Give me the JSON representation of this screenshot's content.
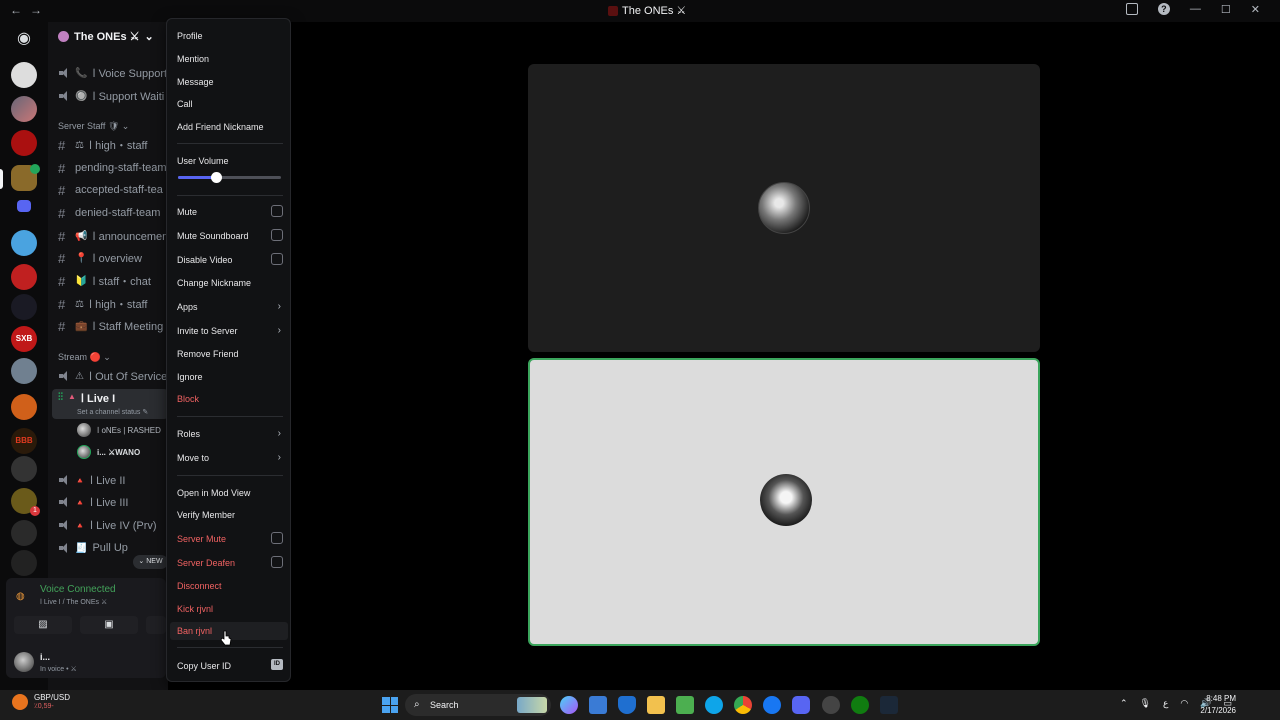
{
  "window": {
    "title": "The ONEs ⚔"
  },
  "sidebar": {
    "server_name": "The ONEs ⚔",
    "channels_top": [
      {
        "label": "ا Voice Support",
        "emoji": "📞"
      },
      {
        "label": "ا Support Waiti",
        "emoji": "🔘"
      }
    ],
    "category_staff": "Server Staff 🛡 ⌄",
    "staff_channels": [
      {
        "label": "ا high・staff",
        "emoji": "⚖"
      },
      {
        "label": "pending-staff-team",
        "emoji": ""
      },
      {
        "label": "accepted-staff-tea",
        "emoji": ""
      },
      {
        "label": "denied-staff-team",
        "emoji": ""
      },
      {
        "label": "ا announcemen",
        "emoji": "📢"
      },
      {
        "label": "ا overview",
        "emoji": "📍"
      },
      {
        "label": "ا staff・chat",
        "emoji": "🔰"
      },
      {
        "label": "ا high・staff",
        "emoji": "⚖"
      },
      {
        "label": "ا Staff Meeting",
        "emoji": "💼"
      }
    ],
    "category_stream": "Stream 🔴 ⌄",
    "stream_channels": [
      {
        "label": "ا Out Of Service",
        "emoji": "⚠"
      }
    ],
    "active_channel": "ا Live I",
    "channel_status": "Set a channel status ✎",
    "members": [
      {
        "name": "ا oNEs | RASHED"
      },
      {
        "name": "i...  ⚔WANO"
      }
    ],
    "more_channels": [
      {
        "label": "ا Live II",
        "emoji": "🔺"
      },
      {
        "label": "ا Live III",
        "emoji": "🔺"
      },
      {
        "label": "ا Live IV (Prv)",
        "emoji": "🔺"
      },
      {
        "label": "Pull Up",
        "emoji": "🧾"
      }
    ],
    "new_pill": "⌄ NEW"
  },
  "voice": {
    "status": "Voice Connected",
    "location": "ا Live I / The ONEs ⚔",
    "user_name": "i...",
    "user_status": "In voice • ⚔"
  },
  "context_menu": {
    "items": [
      {
        "label": "Profile"
      },
      {
        "label": "Mention"
      },
      {
        "label": "Message"
      },
      {
        "label": "Call"
      },
      {
        "label": "Add Friend Nickname"
      },
      {
        "label": "User Volume"
      },
      {
        "label": "Mute"
      },
      {
        "label": "Mute Soundboard"
      },
      {
        "label": "Disable Video"
      },
      {
        "label": "Change Nickname"
      },
      {
        "label": "Apps"
      },
      {
        "label": "Invite to Server"
      },
      {
        "label": "Remove Friend"
      },
      {
        "label": "Ignore"
      },
      {
        "label": "Block"
      },
      {
        "label": "Roles"
      },
      {
        "label": "Move to"
      },
      {
        "label": "Open in Mod View"
      },
      {
        "label": "Verify Member"
      },
      {
        "label": "Server Mute"
      },
      {
        "label": "Server Deafen"
      },
      {
        "label": "Disconnect"
      },
      {
        "label": "Kick rjvnl"
      },
      {
        "label": "Ban rjvnl"
      },
      {
        "label": "Copy User ID"
      }
    ],
    "user_volume_fraction": 0.37,
    "id_badge": "ID"
  },
  "taskbar": {
    "weather_label": "GBP/USD",
    "weather_value": "٪0,59-",
    "search_label": "Search",
    "time": "8:48 PM",
    "date": "2/17/2026",
    "lang": "ع"
  },
  "colors": {
    "accent": "#5865f2",
    "danger": "#f06262",
    "voice_green": "#43a25a",
    "speaking_border": "#3ba55c"
  }
}
